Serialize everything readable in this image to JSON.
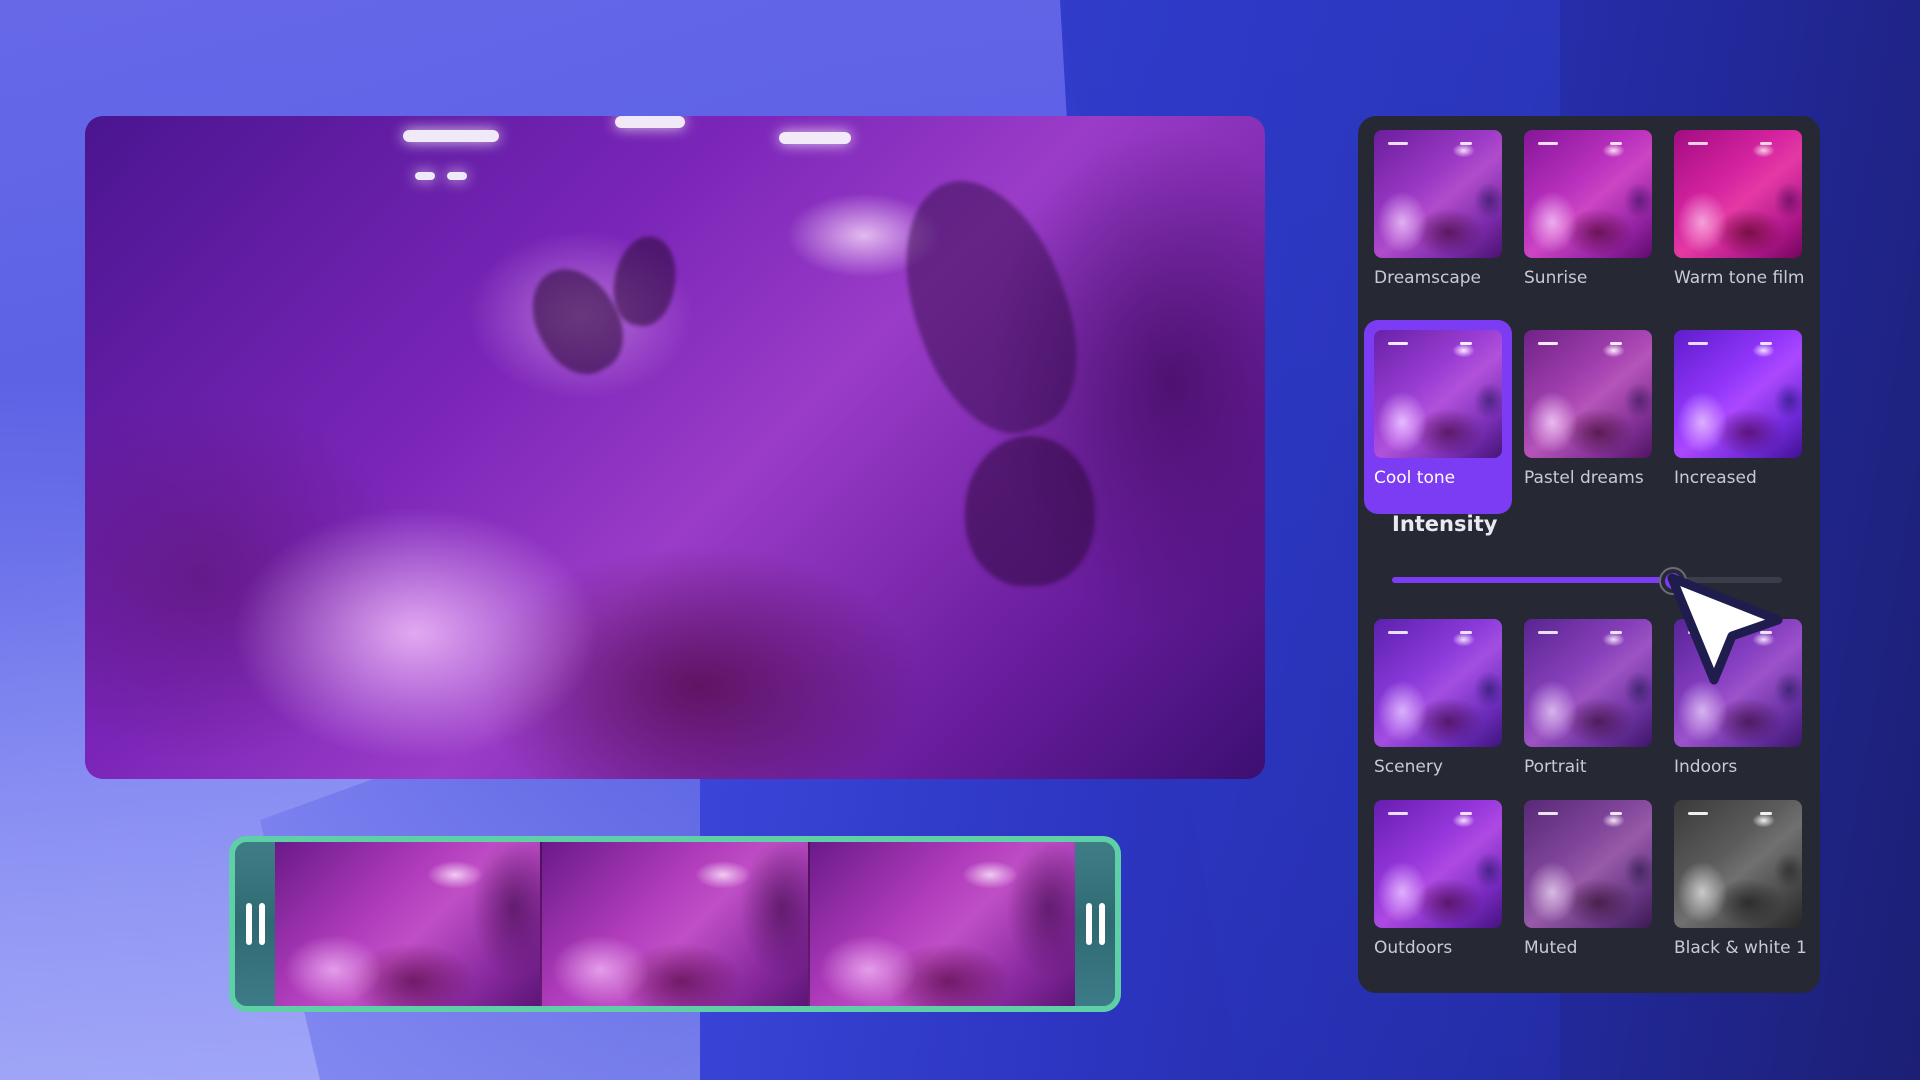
{
  "preview": {
    "description": "Festival crowd video preview with purple Cool tone filter applied"
  },
  "timeline": {
    "frame_count": 3,
    "left_handle_icon": "pause-trim-handle-icon",
    "right_handle_icon": "pause-trim-handle-icon",
    "border_color": "#5ecfa7"
  },
  "filters_panel": {
    "selected_filter": "Cool tone",
    "accent_color": "#7b3cf4",
    "rows_top": [
      {
        "label": "Dreamscape",
        "tone": "dreamscape"
      },
      {
        "label": "Sunrise",
        "tone": "sunrise"
      },
      {
        "label": "Warm tone film",
        "tone": "warm"
      },
      {
        "label": "Cool tone",
        "tone": "cool",
        "selected": true
      },
      {
        "label": "Pastel dreams",
        "tone": "pastel"
      },
      {
        "label": "Increased",
        "tone": "increased"
      }
    ],
    "intensity": {
      "label": "Intensity",
      "value_percent": 72
    },
    "rows_bottom": [
      {
        "label": "Scenery",
        "tone": "scenery"
      },
      {
        "label": "Portrait",
        "tone": "portrait"
      },
      {
        "label": "Indoors",
        "tone": "indoors"
      },
      {
        "label": "Outdoors",
        "tone": "outdoors"
      },
      {
        "label": "Muted",
        "tone": "muted"
      },
      {
        "label": "Black & white 1",
        "tone": "bw"
      }
    ]
  },
  "cursor": {
    "icon": "mouse-pointer-icon"
  }
}
